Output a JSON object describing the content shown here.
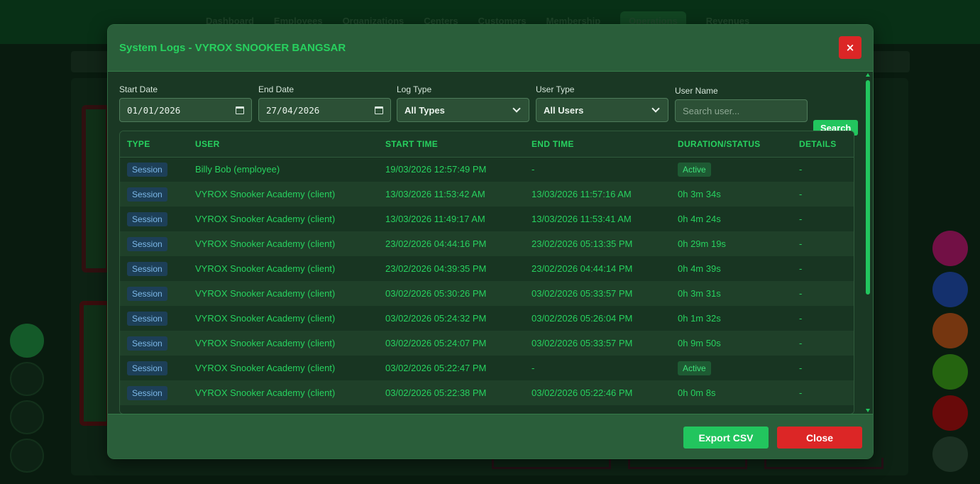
{
  "background": {
    "nav": [
      "Dashboard",
      "Employees",
      "Organizations",
      "Centers",
      "Customers",
      "Membership",
      "Operations",
      "Revenues"
    ],
    "active_nav_index": 6
  },
  "modal": {
    "title": "System Logs - VYROX SNOOKER BANGSAR",
    "close_icon": "×",
    "filters": {
      "start_date": {
        "label": "Start Date",
        "value": "01/01/2026"
      },
      "end_date": {
        "label": "End Date",
        "value": "27/04/2026"
      },
      "log_type": {
        "label": "Log Type",
        "value": "All Types"
      },
      "user_type": {
        "label": "User Type",
        "value": "All Users"
      },
      "user_name": {
        "label": "User Name",
        "placeholder": "Search user..."
      },
      "search_label": "Search"
    },
    "table": {
      "headers": [
        "TYPE",
        "USER",
        "START TIME",
        "END TIME",
        "DURATION/STATUS",
        "DETAILS"
      ],
      "rows": [
        {
          "type": "Session",
          "user": "Billy Bob (employee)",
          "start": "19/03/2026 12:57:49 PM",
          "end": "-",
          "status": "Active",
          "details": "-"
        },
        {
          "type": "Session",
          "user": "VYROX Snooker Academy (client)",
          "start": "13/03/2026 11:53:42 AM",
          "end": "13/03/2026 11:57:16 AM",
          "status": "0h 3m 34s",
          "details": "-"
        },
        {
          "type": "Session",
          "user": "VYROX Snooker Academy (client)",
          "start": "13/03/2026 11:49:17 AM",
          "end": "13/03/2026 11:53:41 AM",
          "status": "0h 4m 24s",
          "details": "-"
        },
        {
          "type": "Session",
          "user": "VYROX Snooker Academy (client)",
          "start": "23/02/2026 04:44:16 PM",
          "end": "23/02/2026 05:13:35 PM",
          "status": "0h 29m 19s",
          "details": "-"
        },
        {
          "type": "Session",
          "user": "VYROX Snooker Academy (client)",
          "start": "23/02/2026 04:39:35 PM",
          "end": "23/02/2026 04:44:14 PM",
          "status": "0h 4m 39s",
          "details": "-"
        },
        {
          "type": "Session",
          "user": "VYROX Snooker Academy (client)",
          "start": "03/02/2026 05:30:26 PM",
          "end": "03/02/2026 05:33:57 PM",
          "status": "0h 3m 31s",
          "details": "-"
        },
        {
          "type": "Session",
          "user": "VYROX Snooker Academy (client)",
          "start": "03/02/2026 05:24:32 PM",
          "end": "03/02/2026 05:26:04 PM",
          "status": "0h 1m 32s",
          "details": "-"
        },
        {
          "type": "Session",
          "user": "VYROX Snooker Academy (client)",
          "start": "03/02/2026 05:24:07 PM",
          "end": "03/02/2026 05:33:57 PM",
          "status": "0h 9m 50s",
          "details": "-"
        },
        {
          "type": "Session",
          "user": "VYROX Snooker Academy (client)",
          "start": "03/02/2026 05:22:47 PM",
          "end": "-",
          "status": "Active",
          "details": "-"
        },
        {
          "type": "Session",
          "user": "VYROX Snooker Academy (client)",
          "start": "03/02/2026 05:22:38 PM",
          "end": "03/02/2026 05:22:46 PM",
          "status": "0h 0m 8s",
          "details": "-"
        }
      ]
    },
    "footer": {
      "export_label": "Export CSV",
      "close_label": "Close"
    }
  },
  "colors": {
    "accent_green": "#22c55e",
    "danger_red": "#dc2626",
    "session_badge_text": "#7cb8e8"
  },
  "icons": {
    "calendar": "calendar-icon",
    "dropdown": "chevron-down-icon",
    "close": "close-icon"
  }
}
